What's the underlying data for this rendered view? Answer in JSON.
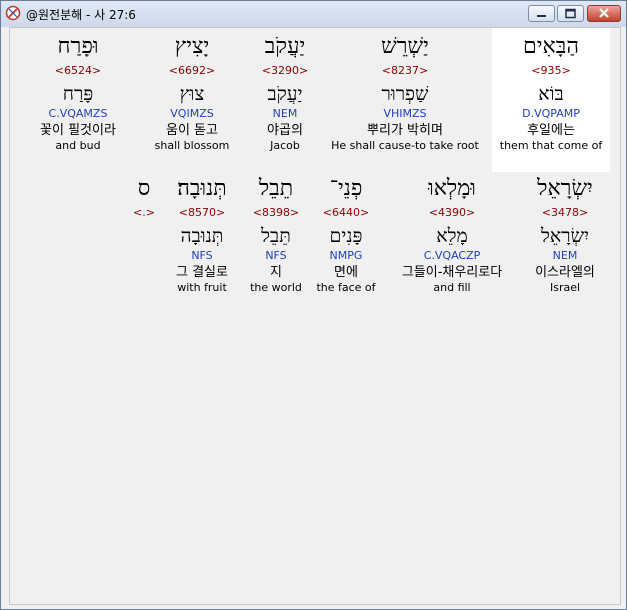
{
  "window": {
    "title": "@원전분해 - 사 27:6"
  },
  "rows": [
    [
      {
        "heb": "וּפָרַח",
        "num": "<6524>",
        "lemma": "פָּרַח",
        "parse": "C.VQAMZS",
        "kor": "꽃이 필것이라",
        "eng": "and bud"
      },
      {
        "heb": "יָצִיץ",
        "num": "<6692>",
        "lemma": "צוּץ",
        "parse": "VQIMZS",
        "kor": "움이 돋고",
        "eng": "shall blossom"
      },
      {
        "heb": "יַעֲקֹב",
        "num": "<3290>",
        "lemma": "יַעֲקֹב",
        "parse": "NEM",
        "kor": "야곱의",
        "eng": "Jacob"
      },
      {
        "heb": "יַשְׁרֵשׁ",
        "num": "<8237>",
        "lemma": "שַׁפְרוּר",
        "parse": "VHIMZS",
        "kor": "뿌리가 박히며",
        "eng": "He shall cause-to take root"
      },
      {
        "heb": "הַבָּאִים",
        "num": "<935>",
        "lemma": "בּוֹא",
        "parse": "D.VQPAMP",
        "kor": "후일에는",
        "eng": "them that come of"
      }
    ],
    [
      {
        "heb": "ס",
        "num": "<.>",
        "lemma": "",
        "parse": "",
        "kor": "",
        "eng": ""
      },
      {
        "heb": "תְּנוּבָה׃",
        "num": "<8570>",
        "lemma": "תְּנוּבָה",
        "parse": "NFS",
        "kor": "그 결실로",
        "eng": "with fruit"
      },
      {
        "heb": "תֵבֵל",
        "num": "<8398>",
        "lemma": "תֵּבֵל",
        "parse": "NFS",
        "kor": "지",
        "eng": "the world"
      },
      {
        "heb": "פְנֵי־",
        "num": "<6440>",
        "lemma": "פָּנִים",
        "parse": "NMPG",
        "kor": "면에",
        "eng": "the face of"
      },
      {
        "heb": "וּמָלְאוּ",
        "num": "<4390>",
        "lemma": "מָלֵא",
        "parse": "C.VQACZP",
        "kor": "그들이-채우리로다",
        "eng": "and fill"
      },
      {
        "heb": "יִשְׂרָאֵל",
        "num": "<3478>",
        "lemma": "יִשְׂרָאֵל",
        "parse": "NEM",
        "kor": "이스라엘의",
        "eng": "Israel"
      }
    ]
  ]
}
